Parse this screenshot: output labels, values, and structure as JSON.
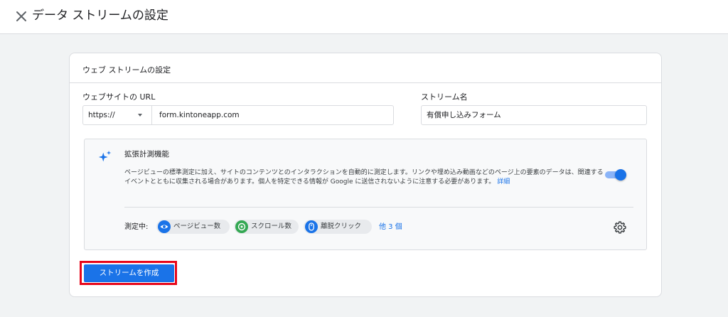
{
  "header": {
    "title": "データ ストリームの設定",
    "close_icon": "close-icon"
  },
  "card": {
    "title": "ウェブ ストリームの設定",
    "url_field": {
      "label": "ウェブサイトの URL",
      "protocol": "https://",
      "value": "form.kintoneapp.com"
    },
    "name_field": {
      "label": "ストリーム名",
      "value": "有償申し込みフォーム"
    },
    "enhanced_measurement": {
      "icon": "sparkle-icon",
      "title": "拡張計測機能",
      "description": "ページビューの標準測定に加え、サイトのコンテンツとのインタラクションを自動的に測定します。リンクや埋め込み動画などのページ上の要素のデータは、関連するイベントとともに収集される場合があります。個人を特定できる情報が Google に送信されないように注意する必要があります。",
      "details_link": "詳細",
      "enabled": true,
      "measuring_label": "測定中:",
      "chips": [
        {
          "label": "ページビュー数",
          "icon": "eye-icon"
        },
        {
          "label": "スクロール数",
          "icon": "scroll-target-icon"
        },
        {
          "label": "離脱クリック",
          "icon": "mouse-icon"
        }
      ],
      "more_link": "他 3 個",
      "settings_icon": "gear-icon"
    },
    "create_button": "ストリームを作成"
  },
  "colors": {
    "accent": "#1a73e8",
    "highlight": "#e8071a",
    "chip_green": "#34a853"
  }
}
